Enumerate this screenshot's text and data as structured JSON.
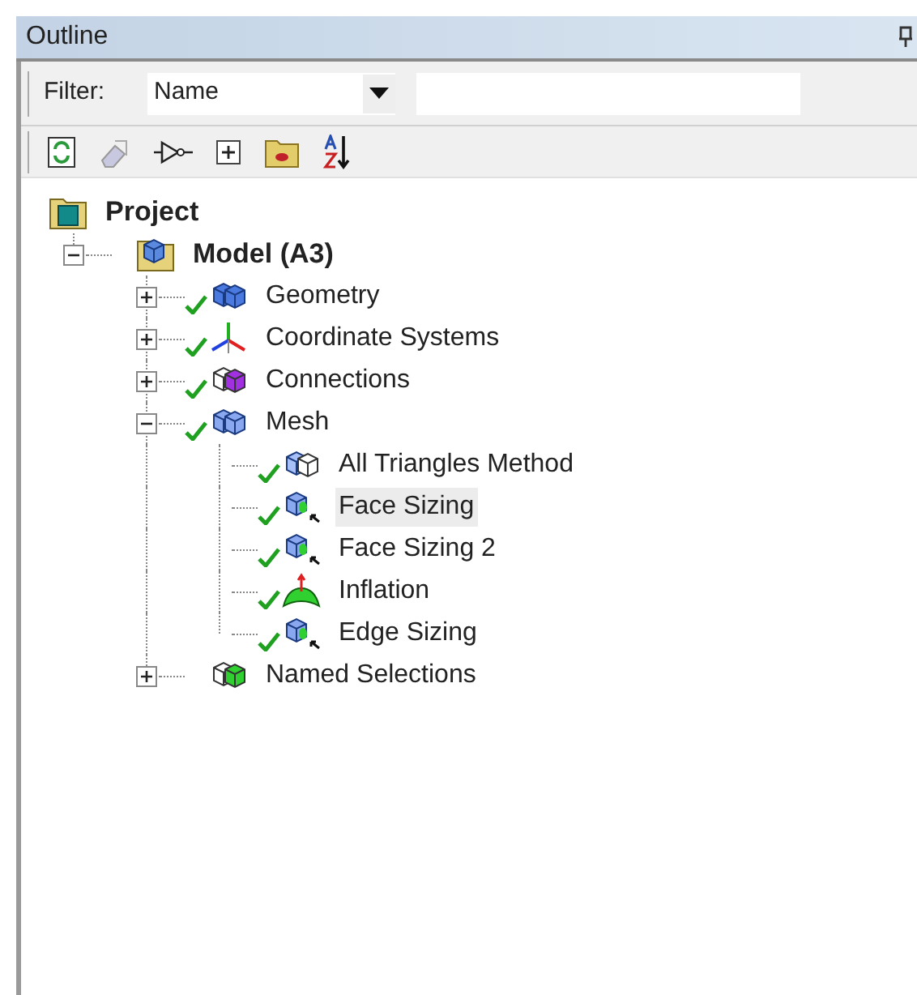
{
  "panel": {
    "title": "Outline"
  },
  "filter": {
    "label": "Filter:",
    "value": "Name"
  },
  "tree": [
    {
      "label": "Project",
      "kind": "project",
      "bold": true,
      "children": [
        {
          "label": "Model (A3)",
          "kind": "model",
          "bold": true,
          "expanded": true,
          "children": [
            {
              "label": "Geometry",
              "kind": "geometry",
              "ok": true,
              "expanded": false
            },
            {
              "label": "Coordinate Systems",
              "kind": "coordinates",
              "ok": true,
              "expanded": false
            },
            {
              "label": "Connections",
              "kind": "connections",
              "ok": true,
              "expanded": false
            },
            {
              "label": "Mesh",
              "kind": "mesh",
              "ok": true,
              "expanded": true,
              "children": [
                {
                  "label": "All Triangles Method",
                  "kind": "method",
                  "ok": true,
                  "selected": false
                },
                {
                  "label": "Face Sizing",
                  "kind": "sizing",
                  "ok": true,
                  "selected": true
                },
                {
                  "label": "Face Sizing 2",
                  "kind": "sizing",
                  "ok": true,
                  "selected": false
                },
                {
                  "label": "Inflation",
                  "kind": "inflation",
                  "ok": true,
                  "selected": false
                },
                {
                  "label": "Edge Sizing",
                  "kind": "sizing",
                  "ok": true,
                  "selected": false
                }
              ]
            },
            {
              "label": "Named Selections",
              "kind": "named",
              "ok": false,
              "expanded": false
            }
          ]
        }
      ]
    }
  ]
}
